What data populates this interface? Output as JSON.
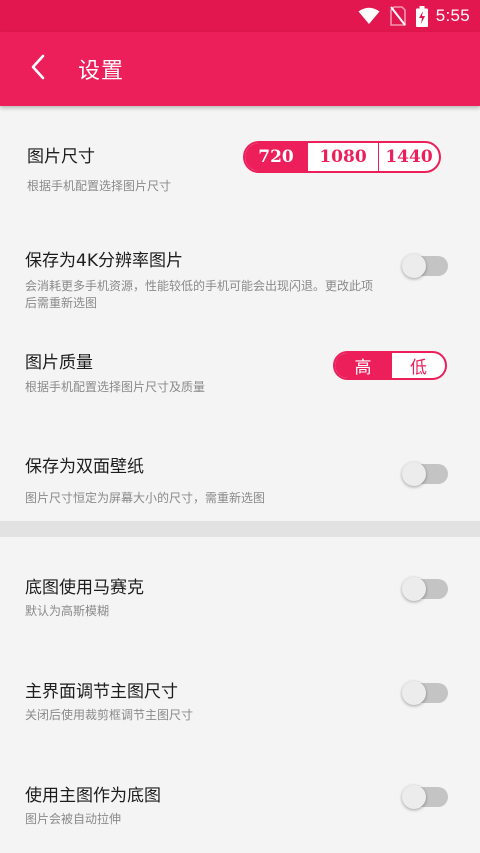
{
  "status_bar": {
    "time": "5:55",
    "icons": [
      "wifi-icon",
      "no-sim-icon",
      "battery-charging-icon"
    ]
  },
  "app_bar": {
    "back_icon": "chevron-left-icon",
    "title": "设置"
  },
  "settings": {
    "image_size": {
      "title": "图片尺寸",
      "subtitle": "根据手机配置选择图片尺寸",
      "options": [
        "720",
        "1080",
        "1440"
      ],
      "selected": "720"
    },
    "save_4k": {
      "title": "保存为4K分辨率图片",
      "subtitle": "会消耗更多手机资源，性能较低的手机可能会出现闪退。更改此项后需重新选图",
      "enabled": false
    },
    "image_quality": {
      "title": "图片质量",
      "subtitle": "根据手机配置选择图片尺寸及质量",
      "options": [
        "高",
        "低"
      ],
      "selected": "高"
    },
    "dual_wallpaper": {
      "title": "保存为双面壁纸",
      "subtitle": "图片尺寸恒定为屏幕大小的尺寸，需重新选图",
      "enabled": false
    },
    "mosaic_background": {
      "title": "底图使用马赛克",
      "subtitle": "默认为高斯模糊",
      "enabled": false
    },
    "main_size_adjust": {
      "title": "主界面调节主图尺寸",
      "subtitle": "关闭后使用裁剪框调节主图尺寸",
      "enabled": false
    },
    "main_as_background": {
      "title": "使用主图作为底图",
      "subtitle": "图片会被自动拉伸",
      "enabled": false
    }
  },
  "colors": {
    "accent": "#ec1f5b",
    "status_bar": "#e3174f",
    "background": "#f4f4f4",
    "toggle_off_track": "#c4c4c4"
  }
}
